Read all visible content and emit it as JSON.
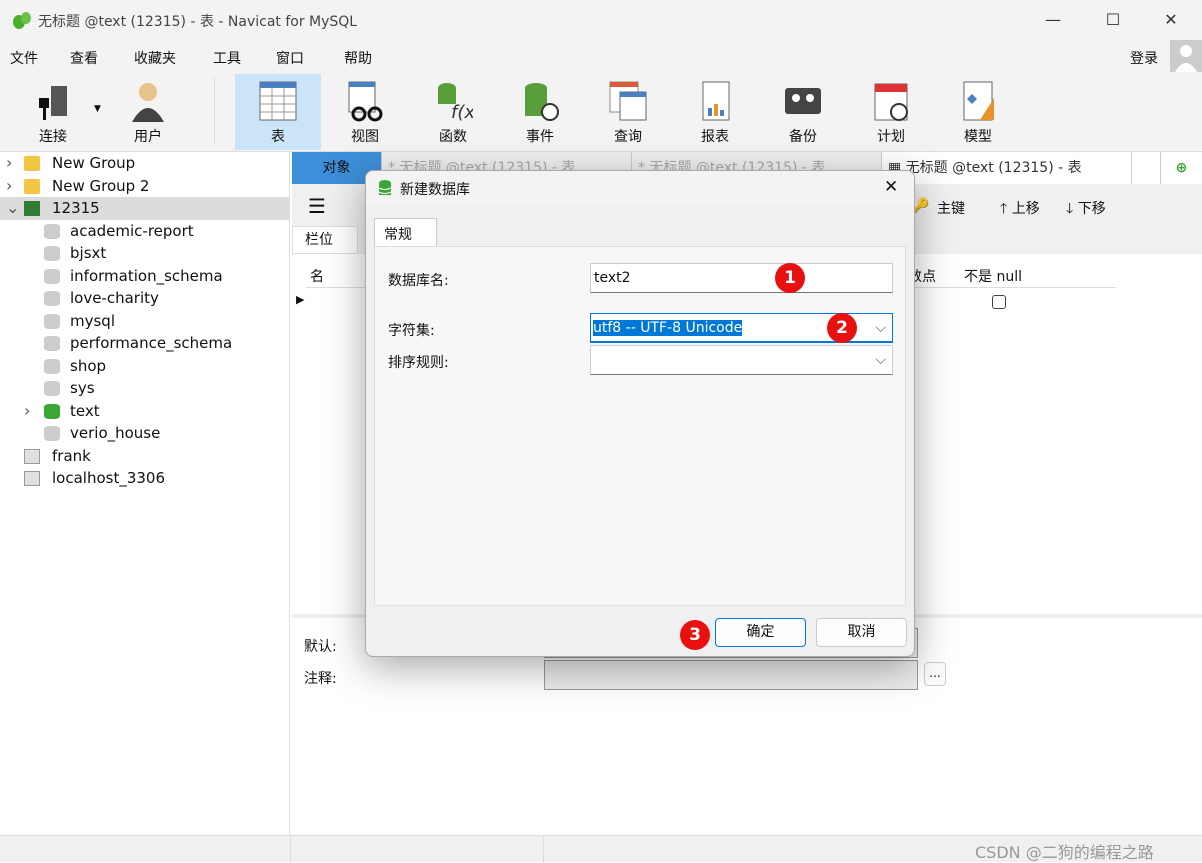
{
  "window": {
    "title": "无标题 @text (12315) - 表 - Navicat for MySQL",
    "minimize": "—",
    "maximize": "☐",
    "close": "✕"
  },
  "menu": [
    "文件",
    "查看",
    "收藏夹",
    "工具",
    "窗口",
    "帮助"
  ],
  "login": "登录",
  "toolbar": [
    {
      "label": "连接",
      "icon": "plug-icon"
    },
    {
      "label": "用户",
      "icon": "user-icon"
    },
    {
      "label": "表",
      "icon": "table-icon",
      "active": true
    },
    {
      "label": "视图",
      "icon": "view-icon"
    },
    {
      "label": "函数",
      "icon": "function-icon"
    },
    {
      "label": "事件",
      "icon": "event-icon"
    },
    {
      "label": "查询",
      "icon": "query-icon"
    },
    {
      "label": "报表",
      "icon": "report-icon"
    },
    {
      "label": "备份",
      "icon": "backup-icon"
    },
    {
      "label": "计划",
      "icon": "schedule-icon"
    },
    {
      "label": "模型",
      "icon": "model-icon"
    }
  ],
  "sidebar": {
    "items": [
      {
        "label": "New Group",
        "type": "folder"
      },
      {
        "label": "New Group 2",
        "type": "folder"
      },
      {
        "label": "12315",
        "type": "connection",
        "expanded": true,
        "selected": true
      },
      {
        "label": "academic-report",
        "type": "db"
      },
      {
        "label": "bjsxt",
        "type": "db"
      },
      {
        "label": "information_schema",
        "type": "db"
      },
      {
        "label": "love-charity",
        "type": "db"
      },
      {
        "label": "mysql",
        "type": "db"
      },
      {
        "label": "performance_schema",
        "type": "db"
      },
      {
        "label": "shop",
        "type": "db"
      },
      {
        "label": "sys",
        "type": "db"
      },
      {
        "label": "text",
        "type": "db-open"
      },
      {
        "label": "verio_house",
        "type": "db"
      },
      {
        "label": "frank",
        "type": "connection-off"
      },
      {
        "label": "localhost_3306",
        "type": "connection-off"
      }
    ]
  },
  "tabs": [
    "对象",
    "* 无标题 @text (12315) - 表",
    "* 无标题 @text (12315) - 表",
    "无标题 @text (12315) - 表"
  ],
  "editor": {
    "primary_key": "主键",
    "move_up": "上移",
    "move_down": "下移",
    "subtab": "栏位",
    "col_name": "名",
    "col_decimal": "数点",
    "col_notnull": "不是 null",
    "default_label": "默认:",
    "comment_label": "注释:",
    "ellipsis": "..."
  },
  "dialog": {
    "title": "新建数据库",
    "tab": "常规",
    "db_name_label": "数据库名:",
    "db_name": "text2",
    "charset_label": "字符集:",
    "charset": "utf8 -- UTF-8 Unicode",
    "collation_label": "排序规则:",
    "collation": "",
    "ok": "确定",
    "cancel": "取消"
  },
  "annotations": [
    "1",
    "2",
    "3"
  ],
  "watermark": "CSDN @二狗的编程之路",
  "colors": {
    "accent": "#3d8fd9",
    "badge": "#e8110f",
    "selection": "#0078d7"
  }
}
